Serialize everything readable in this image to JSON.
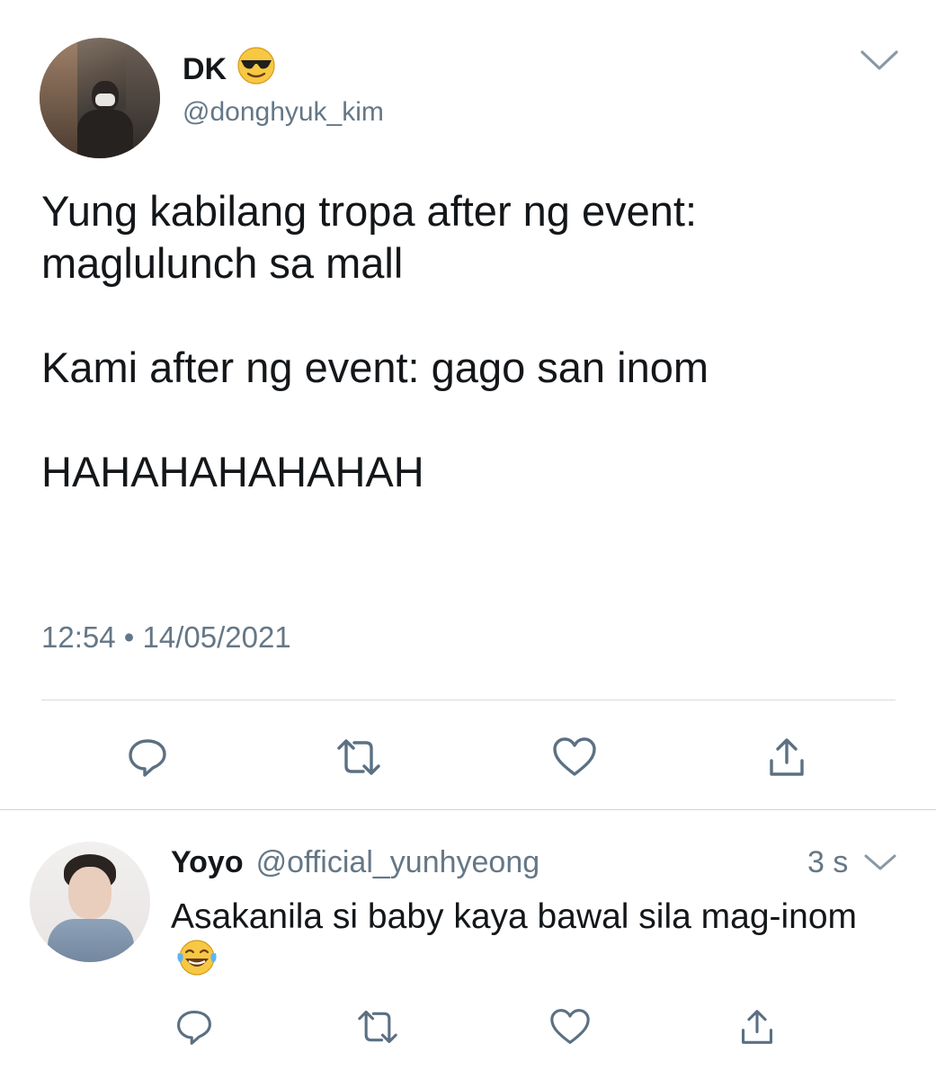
{
  "tweet": {
    "author_name": "DK",
    "author_emoji": "smiling-face-with-sunglasses-emoji",
    "handle": "@donghyuk_kim",
    "text": "Yung kabilang tropa after ng event: maglulunch sa mall\n\nKami after ng event: gago san inom\n\nHAHAHAHAHAHAH",
    "time": "12:54",
    "date_separator": "•",
    "date": "14/05/2021",
    "actions": [
      "reply-icon",
      "retweet-icon",
      "like-icon",
      "share-icon"
    ]
  },
  "reply": {
    "author_name": "Yoyo",
    "handle": "@official_yunhyeong",
    "time_ago": "3 s",
    "text": "Asakanila si baby kaya bawal sila mag-inom",
    "text_emoji": "face-with-tears-of-joy-emoji",
    "actions": [
      "reply-icon",
      "retweet-icon",
      "like-icon",
      "share-icon"
    ]
  },
  "colors": {
    "text": "#14171a",
    "secondary": "#657786",
    "icon": "#5b7083",
    "divider": "#d6dbdf"
  }
}
